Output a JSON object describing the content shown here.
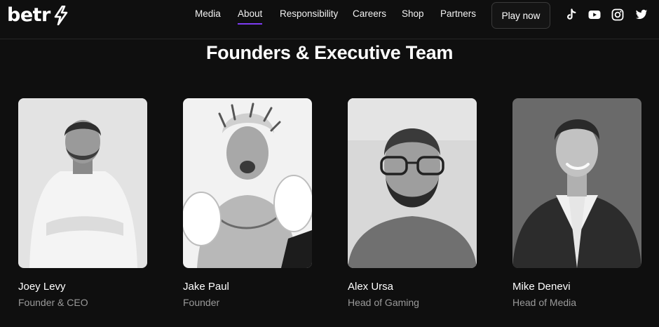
{
  "brand": {
    "name": "betr",
    "accent": "#7d3cf2"
  },
  "nav": {
    "links": [
      {
        "label": "Media",
        "active": false
      },
      {
        "label": "About",
        "active": true
      },
      {
        "label": "Responsibility",
        "active": false
      },
      {
        "label": "Careers",
        "active": false
      },
      {
        "label": "Shop",
        "active": false
      },
      {
        "label": "Partners",
        "active": false
      }
    ],
    "cta_label": "Play now",
    "socials": [
      "tiktok-icon",
      "youtube-icon",
      "instagram-icon",
      "twitter-icon"
    ]
  },
  "section": {
    "title": "Founders & Executive Team",
    "team": [
      {
        "name": "Joey Levy",
        "role": "Founder & CEO"
      },
      {
        "name": "Jake Paul",
        "role": "Founder"
      },
      {
        "name": "Alex Ursa",
        "role": "Head of Gaming"
      },
      {
        "name": "Mike Denevi",
        "role": "Head of Media"
      }
    ]
  },
  "colors": {
    "background": "#0f0f0f",
    "text": "#ffffff",
    "muted": "#9a9a9a"
  }
}
